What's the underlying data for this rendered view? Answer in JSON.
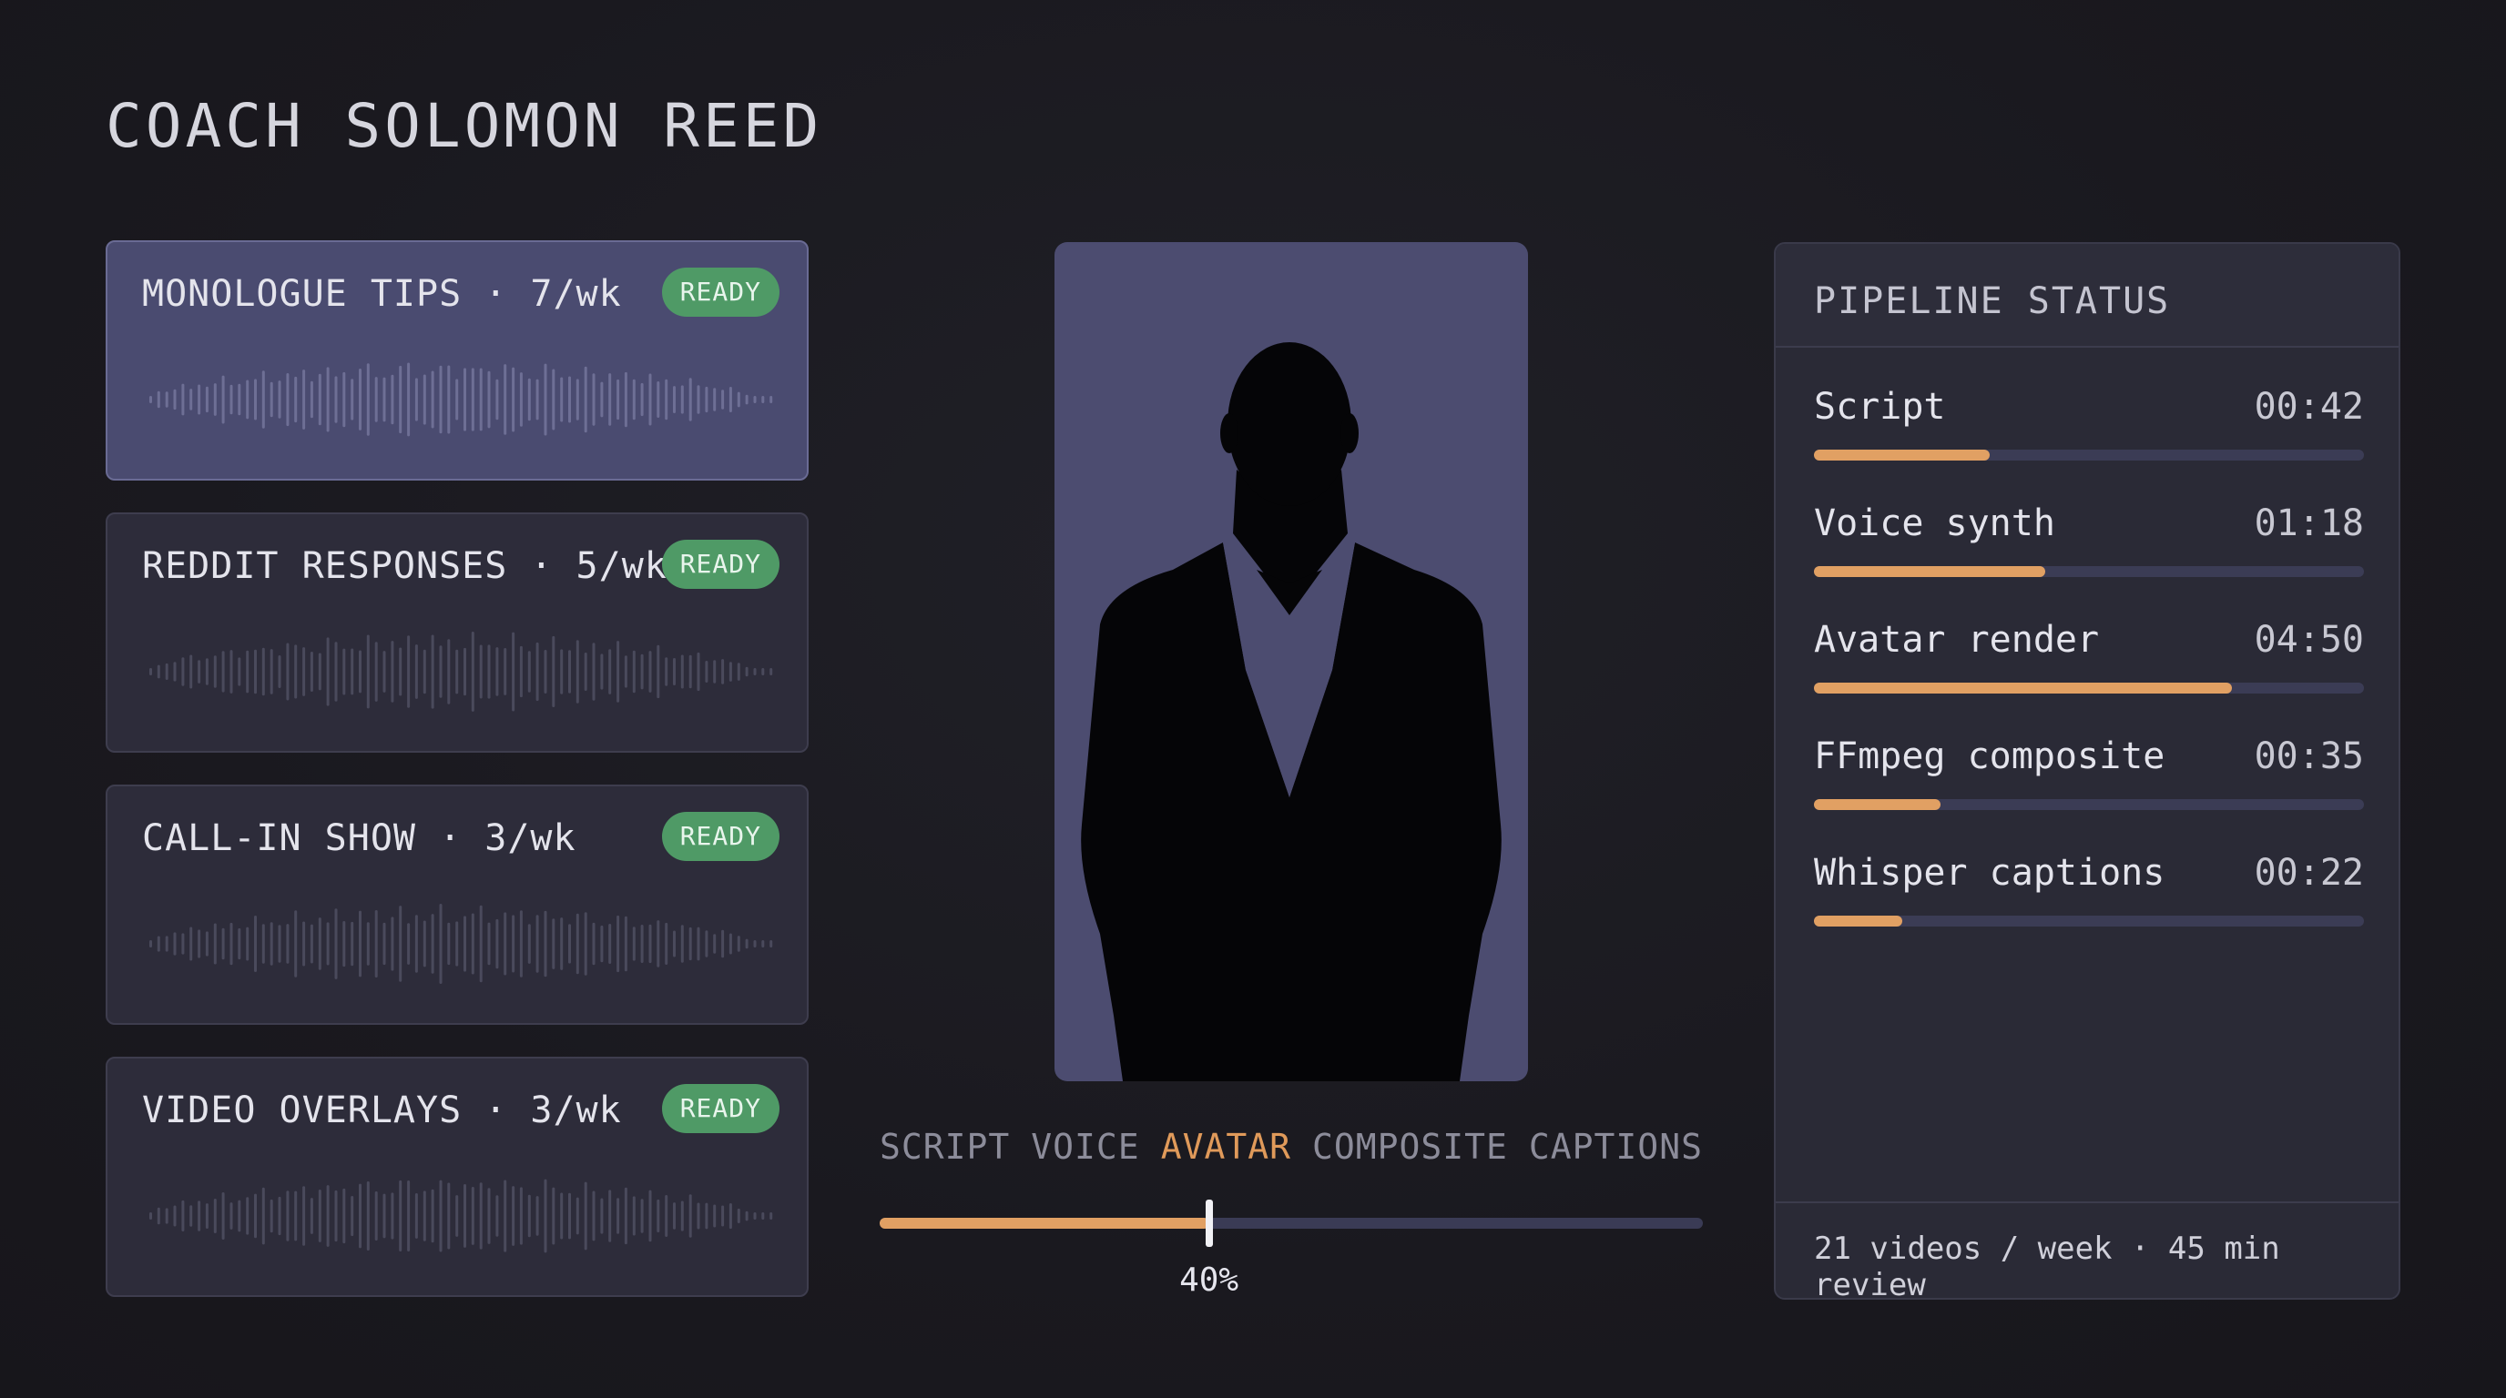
{
  "page": {
    "title": "COACH SOLOMON REED"
  },
  "clips": [
    {
      "title": "MONOLOGUE TIPS · 7/wk",
      "status": "READY",
      "active": true
    },
    {
      "title": "REDDIT RESPONSES · 5/wk",
      "status": "READY",
      "active": false
    },
    {
      "title": "CALL-IN SHOW · 3/wk",
      "status": "READY",
      "active": false
    },
    {
      "title": "VIDEO OVERLAYS · 3/wk",
      "status": "READY",
      "active": false
    }
  ],
  "stepper": {
    "steps": [
      "SCRIPT",
      "VOICE",
      "AVATAR",
      "COMPOSITE",
      "CAPTIONS"
    ],
    "active_index": 2,
    "progress": 0.4,
    "progress_label": "40%"
  },
  "pipeline": {
    "title": "PIPELINE STATUS",
    "stages": [
      {
        "name": "Script",
        "time": "00:42",
        "progress": 0.32
      },
      {
        "name": "Voice synth",
        "time": "01:18",
        "progress": 0.42
      },
      {
        "name": "Avatar render",
        "time": "04:50",
        "progress": 0.76
      },
      {
        "name": "FFmpeg composite",
        "time": "00:35",
        "progress": 0.23
      },
      {
        "name": "Whisper captions",
        "time": "00:22",
        "progress": 0.16
      }
    ],
    "footer": "21 videos / week · 45 min review"
  },
  "colors": {
    "accent": "#e1a063",
    "ready_badge": "#4f9a66",
    "active_card": "#4a4b70",
    "avatar_bg": "#4c4c70"
  },
  "icons": {
    "avatar": "person-silhouette-icon",
    "waveform": "waveform-icon"
  }
}
